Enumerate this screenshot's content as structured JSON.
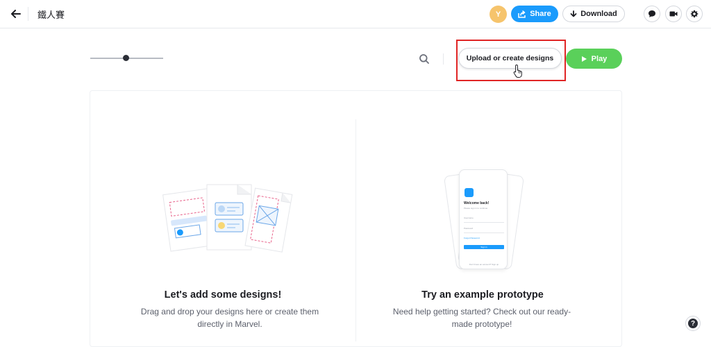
{
  "header": {
    "project_title": "鐵人賽",
    "avatar_initial": "Y",
    "share_label": "Share",
    "download_label": "Download"
  },
  "toolbar": {
    "upload_label": "Upload or create designs",
    "play_label": "Play"
  },
  "cards": [
    {
      "title": "Let's add some designs!",
      "desc_line1": "Drag and drop your designs here or create them",
      "desc_line2": "directly in Marvel."
    },
    {
      "title": "Try an example prototype",
      "desc_line1": "Need help getting started? Check out our ready-",
      "desc_line2": "made prototype!"
    }
  ],
  "phone_mock": {
    "heading": "Welcome back!",
    "subtext": "Please sign in to continue",
    "field1": "Username",
    "field2": "Password",
    "forgot": "Forgot Password",
    "button": "Sign in",
    "footer": "Don't have an account? Sign up"
  },
  "help_label": "?",
  "colors": {
    "accent_blue": "#1a9bfc",
    "play_green": "#5ad05a",
    "avatar_yellow": "#f6c46c",
    "highlight_red": "#e02424"
  }
}
